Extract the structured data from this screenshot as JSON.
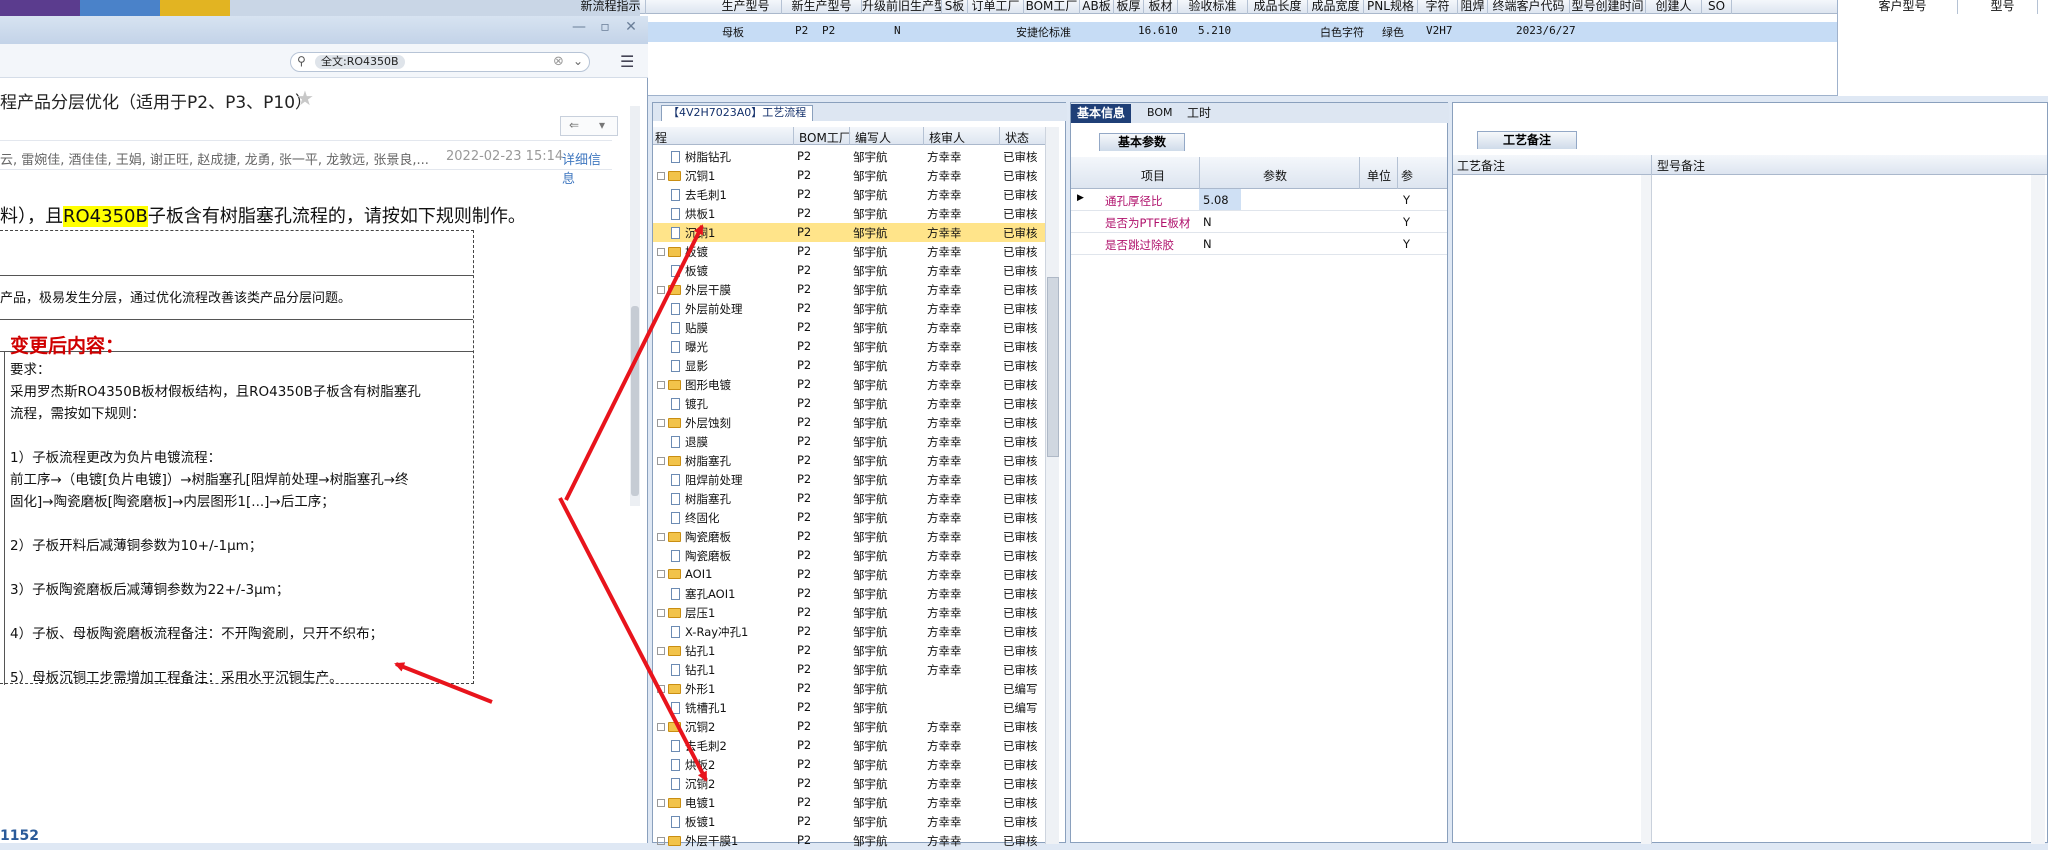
{
  "top_grid": {
    "headers": [
      "新流程指示",
      "生产型号",
      "新生产型号",
      "升级前旧生产型号",
      "S板",
      "订单工厂",
      "BOM工厂",
      "AB板",
      "板厚",
      "板材",
      "验收标准",
      "成品长度",
      "成品宽度",
      "PNL规格",
      "字符",
      "阻焊",
      "终端客户代码",
      "型号创建时间",
      "创建人",
      "SO",
      "客户型号",
      "型号"
    ],
    "row": {
      "type": "母板",
      "order_factory": "P2",
      "bom_factory": "P2",
      "ab": "N",
      "standard": "安捷伦标准",
      "length": "16.610",
      "width": "5.210",
      "char": "白色字符",
      "mask": "绿色",
      "customer_code": "V2H7",
      "created": "2023/6/27"
    }
  },
  "mail": {
    "search_value": "全文:RO4350B",
    "subject": "程产品分层优化（适用于P2、P3、P10）",
    "recipients": "云, 雷婉佳, 酒佳佳, 王娟, 谢正旺, 赵成捷, 龙勇, 张一平, 龙敦远, 张景良,...",
    "date": "2022-02-23 15:14",
    "detail_link": "详细信息",
    "intro_pre": "料），且",
    "intro_hl": "RO4350B",
    "intro_post": "子板含有树脂塞孔流程的，请按如下规则制作。",
    "row1": "产品，极易发生分层，通过优化流程改善该类产品分层问题。",
    "after_heading": "变更后内容：",
    "requirements": [
      "要求：",
      "采用罗杰斯RO4350B板材假板结构，且RO4350B子板含有树脂塞孔",
      "流程，需按如下规则：",
      "",
      "1）子板流程更改为负片电镀流程：",
      "前工序→（电镀[负片电镀]）→树脂塞孔[阻焊前处理→树脂塞孔→终",
      "固化]→陶瓷磨板[陶瓷磨板]→内层图形1[...]→后工序；",
      "",
      "2）子板开料后减薄铜参数为10+/-1μm；",
      "",
      "3）子板陶瓷磨板后减薄铜参数为22+/-3μm；",
      "",
      "4）子板、母板陶瓷磨板流程备注：不开陶瓷刷，只开不织布；",
      "",
      "5）母板沉铜工步需增加工程备注：采用水平沉铜生产。"
    ],
    "footer_number": "1152"
  },
  "tree": {
    "tab_label": "【4V2H7023A0】工艺流程",
    "headers": [
      "程",
      "BOM工厂",
      "编写人",
      "核审人",
      "状态"
    ],
    "rows": [
      {
        "level": 1,
        "name": "树脂钻孔",
        "bom": "P2",
        "writer": "邹宇航",
        "reviewer": "方幸幸",
        "status": "已审核"
      },
      {
        "level": 0,
        "name": "沉铜1",
        "bom": "P2",
        "writer": "邹宇航",
        "reviewer": "方幸幸",
        "status": "已审核"
      },
      {
        "level": 1,
        "name": "去毛刺1",
        "bom": "P2",
        "writer": "邹宇航",
        "reviewer": "方幸幸",
        "status": "已审核"
      },
      {
        "level": 1,
        "name": "烘板1",
        "bom": "P2",
        "writer": "邹宇航",
        "reviewer": "方幸幸",
        "status": "已审核"
      },
      {
        "level": 1,
        "name": "沉铜1",
        "bom": "P2",
        "writer": "邹宇航",
        "reviewer": "方幸幸",
        "status": "已审核",
        "selected": true
      },
      {
        "level": 0,
        "name": "板镀",
        "bom": "P2",
        "writer": "邹宇航",
        "reviewer": "方幸幸",
        "status": "已审核"
      },
      {
        "level": 1,
        "name": "板镀",
        "bom": "P2",
        "writer": "邹宇航",
        "reviewer": "方幸幸",
        "status": "已审核"
      },
      {
        "level": 0,
        "name": "外层干膜",
        "bom": "P2",
        "writer": "邹宇航",
        "reviewer": "方幸幸",
        "status": "已审核"
      },
      {
        "level": 1,
        "name": "外层前处理",
        "bom": "P2",
        "writer": "邹宇航",
        "reviewer": "方幸幸",
        "status": "已审核"
      },
      {
        "level": 1,
        "name": "贴膜",
        "bom": "P2",
        "writer": "邹宇航",
        "reviewer": "方幸幸",
        "status": "已审核"
      },
      {
        "level": 1,
        "name": "曝光",
        "bom": "P2",
        "writer": "邹宇航",
        "reviewer": "方幸幸",
        "status": "已审核"
      },
      {
        "level": 1,
        "name": "显影",
        "bom": "P2",
        "writer": "邹宇航",
        "reviewer": "方幸幸",
        "status": "已审核"
      },
      {
        "level": 0,
        "name": "图形电镀",
        "bom": "P2",
        "writer": "邹宇航",
        "reviewer": "方幸幸",
        "status": "已审核"
      },
      {
        "level": 1,
        "name": "镀孔",
        "bom": "P2",
        "writer": "邹宇航",
        "reviewer": "方幸幸",
        "status": "已审核"
      },
      {
        "level": 0,
        "name": "外层蚀刻",
        "bom": "P2",
        "writer": "邹宇航",
        "reviewer": "方幸幸",
        "status": "已审核"
      },
      {
        "level": 1,
        "name": "退膜",
        "bom": "P2",
        "writer": "邹宇航",
        "reviewer": "方幸幸",
        "status": "已审核"
      },
      {
        "level": 0,
        "name": "树脂塞孔",
        "bom": "P2",
        "writer": "邹宇航",
        "reviewer": "方幸幸",
        "status": "已审核"
      },
      {
        "level": 1,
        "name": "阻焊前处理",
        "bom": "P2",
        "writer": "邹宇航",
        "reviewer": "方幸幸",
        "status": "已审核"
      },
      {
        "level": 1,
        "name": "树脂塞孔",
        "bom": "P2",
        "writer": "邹宇航",
        "reviewer": "方幸幸",
        "status": "已审核"
      },
      {
        "level": 1,
        "name": "终固化",
        "bom": "P2",
        "writer": "邹宇航",
        "reviewer": "方幸幸",
        "status": "已审核"
      },
      {
        "level": 0,
        "name": "陶瓷磨板",
        "bom": "P2",
        "writer": "邹宇航",
        "reviewer": "方幸幸",
        "status": "已审核"
      },
      {
        "level": 1,
        "name": "陶瓷磨板",
        "bom": "P2",
        "writer": "邹宇航",
        "reviewer": "方幸幸",
        "status": "已审核"
      },
      {
        "level": 0,
        "name": "AOI1",
        "bom": "P2",
        "writer": "邹宇航",
        "reviewer": "方幸幸",
        "status": "已审核"
      },
      {
        "level": 1,
        "name": "塞孔AOI1",
        "bom": "P2",
        "writer": "邹宇航",
        "reviewer": "方幸幸",
        "status": "已审核"
      },
      {
        "level": 0,
        "name": "层压1",
        "bom": "P2",
        "writer": "邹宇航",
        "reviewer": "方幸幸",
        "status": "已审核"
      },
      {
        "level": 1,
        "name": "X-Ray冲孔1",
        "bom": "P2",
        "writer": "邹宇航",
        "reviewer": "方幸幸",
        "status": "已审核"
      },
      {
        "level": 0,
        "name": "钻孔1",
        "bom": "P2",
        "writer": "邹宇航",
        "reviewer": "方幸幸",
        "status": "已审核"
      },
      {
        "level": 1,
        "name": "钻孔1",
        "bom": "P2",
        "writer": "邹宇航",
        "reviewer": "方幸幸",
        "status": "已审核"
      },
      {
        "level": 0,
        "name": "外形1",
        "bom": "P2",
        "writer": "邹宇航",
        "reviewer": "",
        "status": "已编写"
      },
      {
        "level": 1,
        "name": "铣槽孔1",
        "bom": "P2",
        "writer": "邹宇航",
        "reviewer": "",
        "status": "已编写"
      },
      {
        "level": 0,
        "name": "沉铜2",
        "bom": "P2",
        "writer": "邹宇航",
        "reviewer": "方幸幸",
        "status": "已审核"
      },
      {
        "level": 1,
        "name": "去毛刺2",
        "bom": "P2",
        "writer": "邹宇航",
        "reviewer": "方幸幸",
        "status": "已审核"
      },
      {
        "level": 1,
        "name": "烘板2",
        "bom": "P2",
        "writer": "邹宇航",
        "reviewer": "方幸幸",
        "status": "已审核"
      },
      {
        "level": 1,
        "name": "沉铜2",
        "bom": "P2",
        "writer": "邹宇航",
        "reviewer": "方幸幸",
        "status": "已审核"
      },
      {
        "level": 0,
        "name": "电镀1",
        "bom": "P2",
        "writer": "邹宇航",
        "reviewer": "方幸幸",
        "status": "已审核"
      },
      {
        "level": 1,
        "name": "板镀1",
        "bom": "P2",
        "writer": "邹宇航",
        "reviewer": "方幸幸",
        "status": "已审核"
      },
      {
        "level": 0,
        "name": "外层干膜1",
        "bom": "P2",
        "writer": "邹宇航",
        "reviewer": "方幸幸",
        "status": "已审核"
      }
    ]
  },
  "info": {
    "tabs": [
      "基本信息",
      "BOM",
      "工时"
    ],
    "param_tab": "基本参数",
    "headers": [
      "项目",
      "参数",
      "单位",
      "参"
    ],
    "rows": [
      {
        "item": "通孔厚径比",
        "value": "5.08",
        "unit": "",
        "flag": "Y"
      },
      {
        "item": "是否为PTFE板材",
        "value": "N",
        "unit": "",
        "flag": "Y"
      },
      {
        "item": "是否跳过除胶",
        "value": "N",
        "unit": "",
        "flag": "Y"
      }
    ]
  },
  "remark": {
    "tab": "工艺备注",
    "headers": [
      "工艺备注",
      "型号备注"
    ]
  },
  "colors": {
    "arrow": "#e8141c",
    "accent": "#1f3f77",
    "highlight": "#ffff00",
    "selected_row": "#ffe48a",
    "heading_red": "#d00000"
  }
}
